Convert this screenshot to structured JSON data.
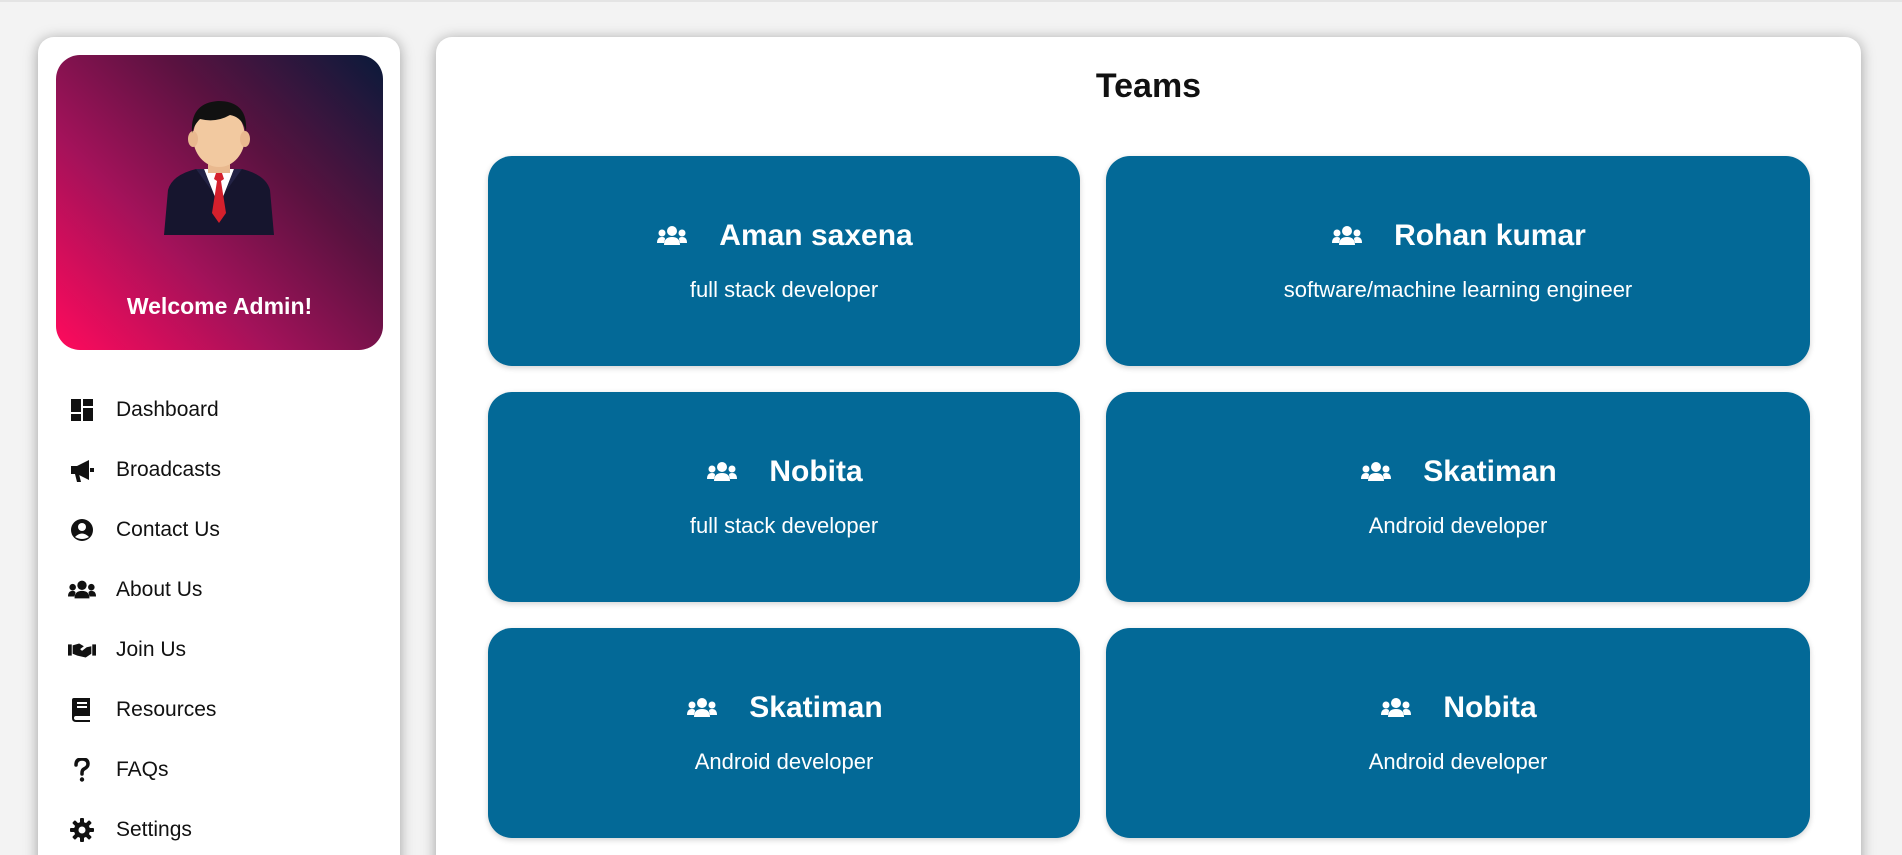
{
  "sidebar": {
    "welcome": "Welcome Admin!",
    "gradient": [
      "#ff0a5c",
      "#0a1a3a"
    ],
    "items": [
      {
        "label": "Dashboard",
        "icon": "dashboard-icon"
      },
      {
        "label": "Broadcasts",
        "icon": "megaphone-icon"
      },
      {
        "label": "Contact Us",
        "icon": "user-circle-icon"
      },
      {
        "label": "About Us",
        "icon": "users-icon"
      },
      {
        "label": "Join Us",
        "icon": "handshake-icon"
      },
      {
        "label": "Resources",
        "icon": "book-icon"
      },
      {
        "label": "FAQs",
        "icon": "question-icon"
      },
      {
        "label": "Settings",
        "icon": "gear-icon"
      }
    ]
  },
  "main": {
    "title": "Teams",
    "card_color": "#036997",
    "cards": [
      {
        "name": "Aman saxena",
        "role": "full stack developer",
        "icon": "users-icon"
      },
      {
        "name": "Rohan kumar",
        "role": "software/machine learning engineer",
        "icon": "users-icon"
      },
      {
        "name": "Nobita",
        "role": "full stack developer",
        "icon": "users-icon"
      },
      {
        "name": "Skatiman",
        "role": "Android developer",
        "icon": "users-icon"
      },
      {
        "name": "Skatiman",
        "role": "Android developer",
        "icon": "users-icon"
      },
      {
        "name": "Nobita",
        "role": "Android developer",
        "icon": "users-icon"
      }
    ]
  }
}
